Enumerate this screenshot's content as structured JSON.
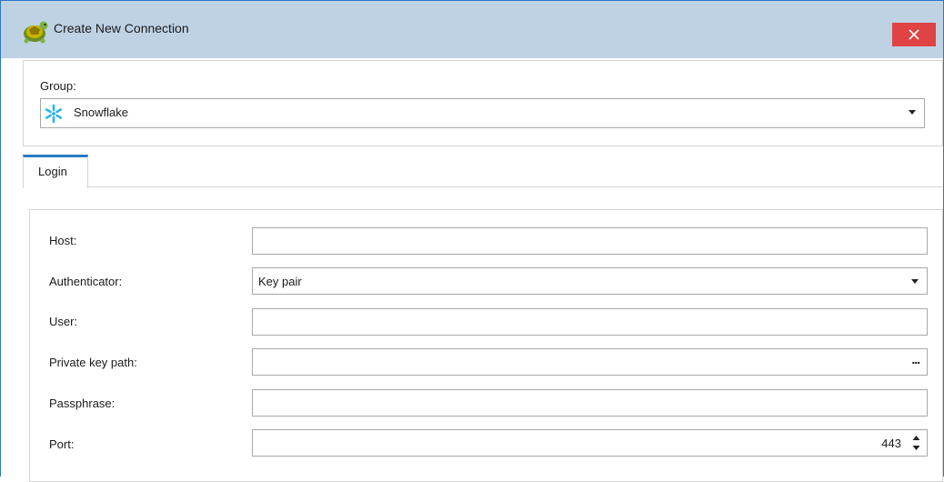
{
  "window": {
    "title": "Create New Connection",
    "close_symbol": "×",
    "app_icon": "turtle-app-icon",
    "accent_color": "#2b78c4",
    "close_color": "#e04343"
  },
  "group": {
    "label": "Group:",
    "selected": "Snowflake",
    "icon": "snowflake-icon"
  },
  "tabs": [
    {
      "label": "Login",
      "active": true
    }
  ],
  "login": {
    "host": {
      "label": "Host:",
      "value": ""
    },
    "authenticator": {
      "label": "Authenticator:",
      "value": "Key pair"
    },
    "user": {
      "label": "User:",
      "value": ""
    },
    "private_key_path": {
      "label": "Private key path:",
      "value": "",
      "browse": "..."
    },
    "passphrase": {
      "label": "Passphrase:",
      "value": ""
    },
    "port": {
      "label": "Port:",
      "value": "443"
    }
  }
}
